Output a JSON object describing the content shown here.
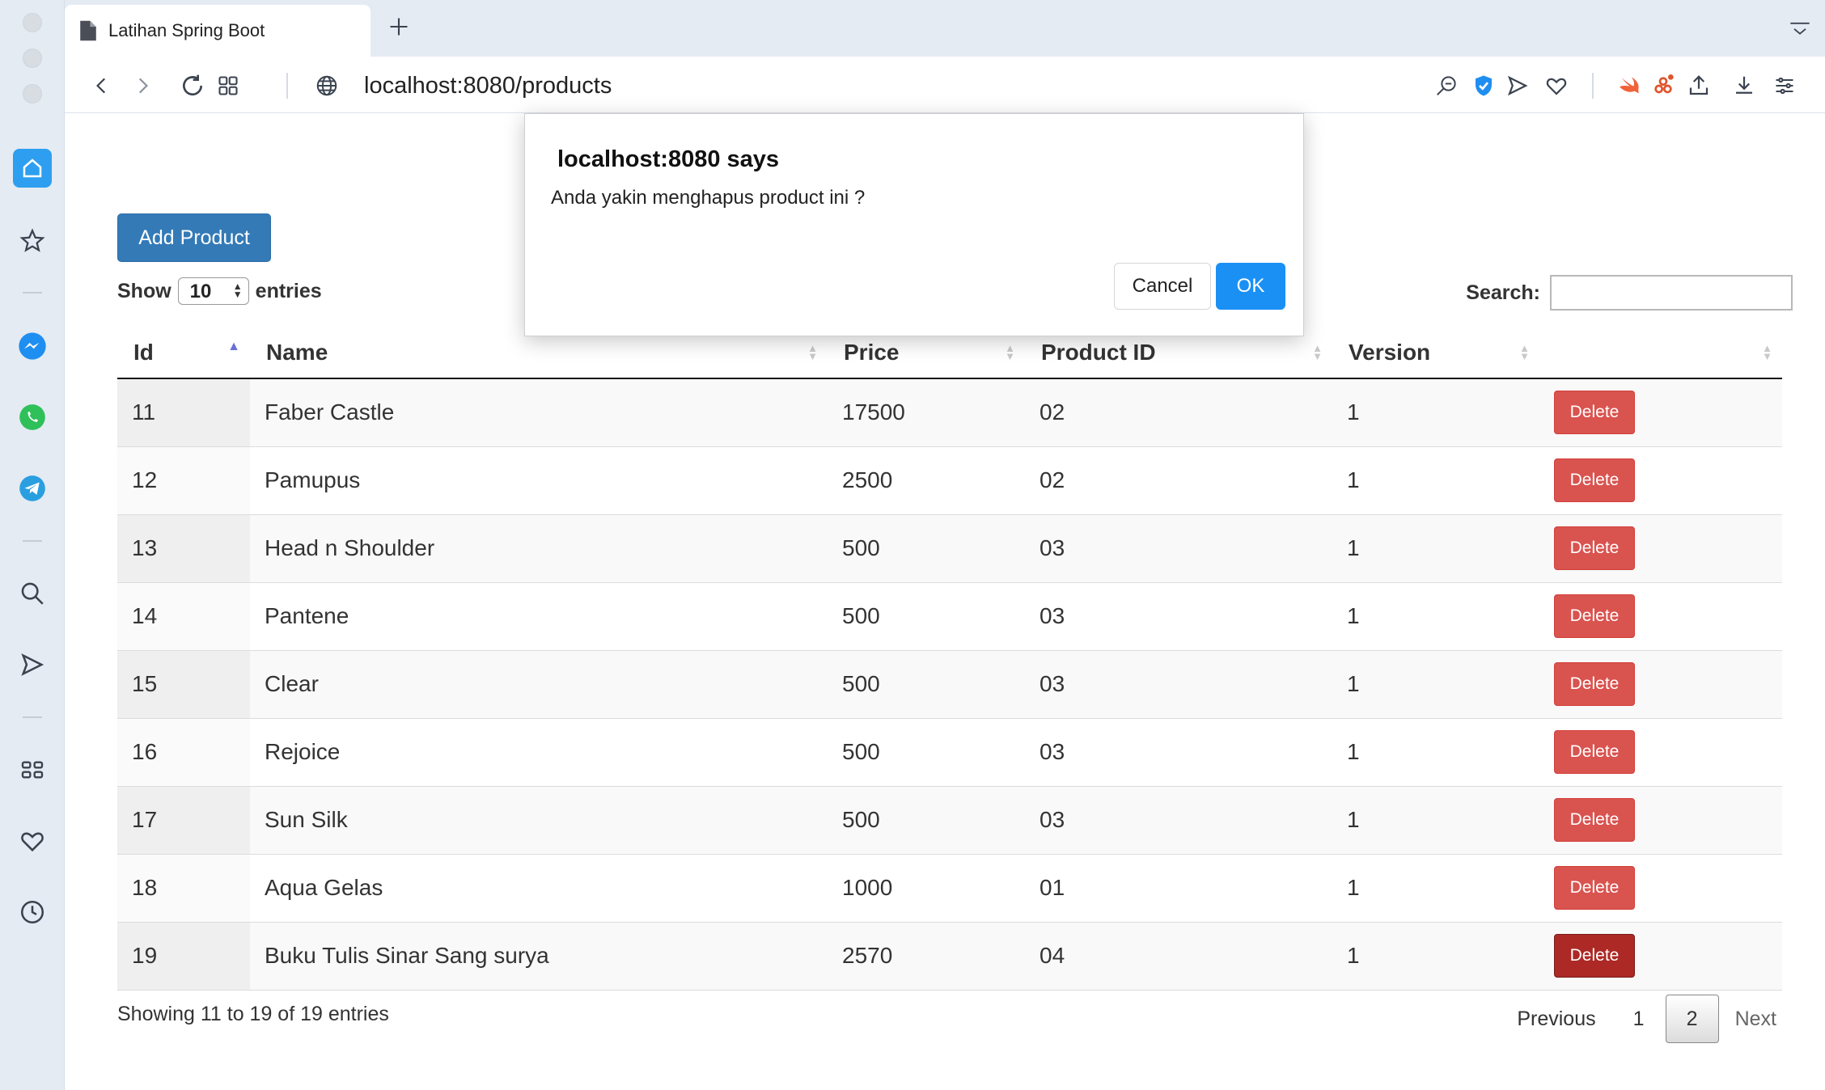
{
  "browser": {
    "tab_title": "Latihan Spring Boot",
    "url": "localhost:8080/products"
  },
  "page": {
    "add_button": "Add Product",
    "length_show": "Show",
    "length_value": "10",
    "length_entries": "entries",
    "search_label": "Search:",
    "search_value": "",
    "columns": [
      "Id",
      "Name",
      "Price",
      "Product ID",
      "Version",
      ""
    ],
    "rows": [
      {
        "id": "11",
        "name": "Faber Castle",
        "price": "17500",
        "product_id": "02",
        "version": "1",
        "action": "Delete"
      },
      {
        "id": "12",
        "name": "Pamupus",
        "price": "2500",
        "product_id": "02",
        "version": "1",
        "action": "Delete"
      },
      {
        "id": "13",
        "name": "Head n Shoulder",
        "price": "500",
        "product_id": "03",
        "version": "1",
        "action": "Delete"
      },
      {
        "id": "14",
        "name": "Pantene",
        "price": "500",
        "product_id": "03",
        "version": "1",
        "action": "Delete"
      },
      {
        "id": "15",
        "name": "Clear",
        "price": "500",
        "product_id": "03",
        "version": "1",
        "action": "Delete"
      },
      {
        "id": "16",
        "name": "Rejoice",
        "price": "500",
        "product_id": "03",
        "version": "1",
        "action": "Delete"
      },
      {
        "id": "17",
        "name": "Sun Silk",
        "price": "500",
        "product_id": "03",
        "version": "1",
        "action": "Delete"
      },
      {
        "id": "18",
        "name": "Aqua Gelas",
        "price": "1000",
        "product_id": "01",
        "version": "1",
        "action": "Delete"
      },
      {
        "id": "19",
        "name": "Buku Tulis Sinar Sang surya",
        "price": "2570",
        "product_id": "04",
        "version": "1",
        "action": "Delete"
      }
    ],
    "info": "Showing 11 to 19 of 19 entries",
    "pager": {
      "previous": "Previous",
      "page1": "1",
      "page2": "2",
      "next": "Next"
    }
  },
  "dialog": {
    "title": "localhost:8080 says",
    "message": "Anda yakin menghapus product ini ?",
    "cancel": "Cancel",
    "ok": "OK"
  },
  "colors": {
    "primary": "#337ab7",
    "danger": "#d9534f",
    "danger_active": "#ac2925",
    "dialog_ok": "#1a90f5",
    "sidebar_active": "#2e9ff0"
  }
}
